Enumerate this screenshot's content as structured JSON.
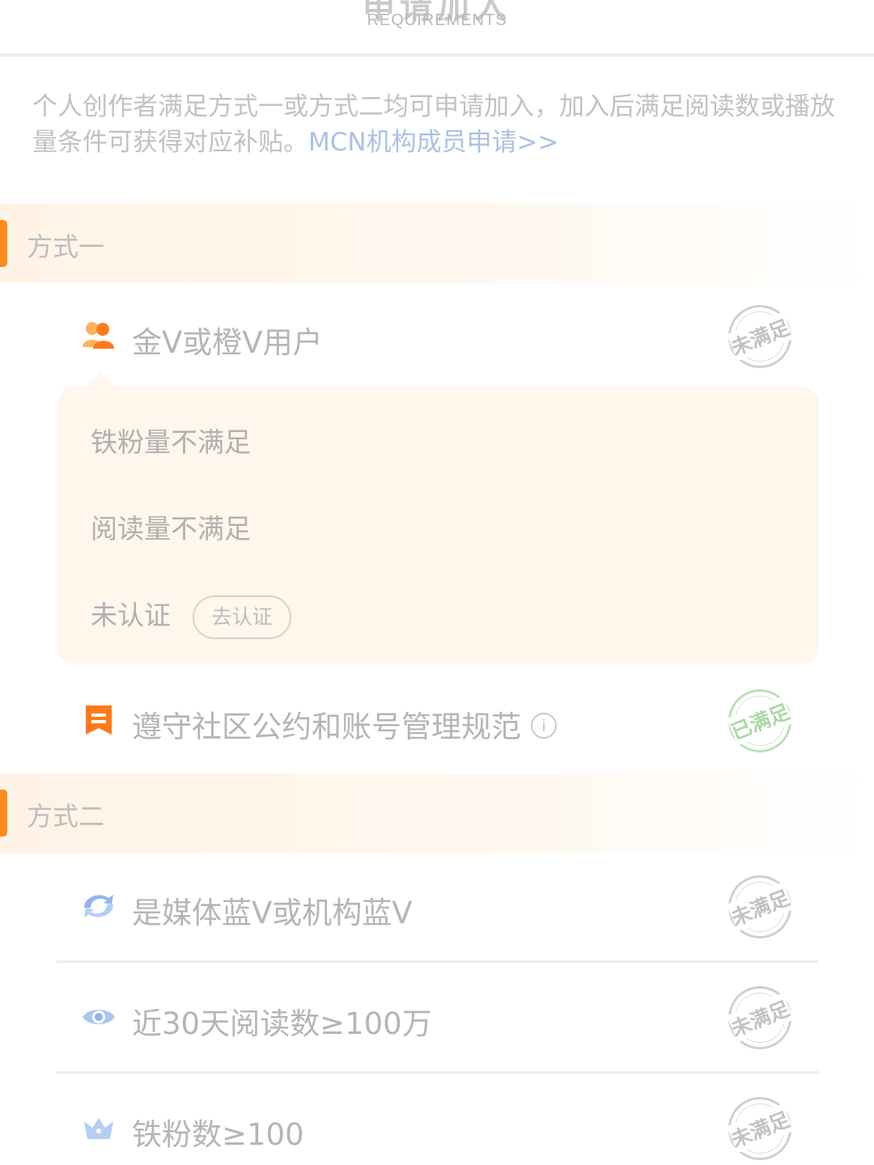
{
  "header": {
    "title": "申请加入",
    "subtitle": "REQUIREMENTS"
  },
  "intro": {
    "text": "个人创作者满足方式一或方式二均可申请加入，加入后满足阅读数或播放量条件可获得对应补贴。",
    "link": "MCN机构成员申请>>"
  },
  "method1": {
    "title": "方式一",
    "items": [
      {
        "label": "金V或橙V用户",
        "icon": "users-icon",
        "status": "未满足"
      },
      {
        "label": "遵守社区公约和账号管理规范",
        "icon": "bookmark-icon",
        "status": "已满足"
      }
    ],
    "details": {
      "fans": "铁粉量不满足",
      "reads": "阅读量不满足",
      "verify_status": "未认证",
      "verify_button": "去认证"
    }
  },
  "method2": {
    "title": "方式二",
    "items": [
      {
        "label": "是媒体蓝V或机构蓝V",
        "icon": "blue-v-icon",
        "status": "未满足"
      },
      {
        "label": "近30天阅读数≥100万",
        "icon": "eye-icon",
        "status": "未满足"
      },
      {
        "label": "铁粉数≥100",
        "icon": "crown-icon",
        "status": "未满足"
      }
    ]
  },
  "colors": {
    "accent": "#ff8a1e",
    "link": "#a9c2e4",
    "satisfied": "#aad9a6",
    "unsatisfied": "#c2c2c2",
    "section_bg": "#fff3e6"
  }
}
